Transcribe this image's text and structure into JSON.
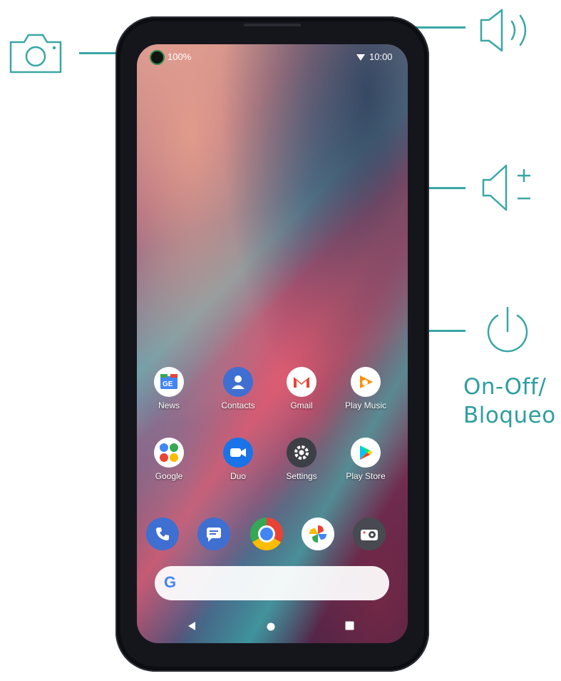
{
  "callouts": {
    "power_label_line1": "On-Off/",
    "power_label_line2": "Bloqueo",
    "icons": [
      "camera-icon",
      "speaker-icon",
      "volume-rocker-icon",
      "power-icon"
    ]
  },
  "status_bar": {
    "battery": "100%",
    "time": "10:00",
    "icons": [
      "wifi-icon"
    ]
  },
  "home": {
    "apps_row1": [
      {
        "label": "News",
        "icon": "news-icon",
        "color": "#ffffff"
      },
      {
        "label": "Contacts",
        "icon": "contacts-icon",
        "color": "#3f6fd1"
      },
      {
        "label": "Gmail",
        "icon": "gmail-icon",
        "color": "#ffffff"
      },
      {
        "label": "Play Music",
        "icon": "play-music-icon",
        "color": "#ffffff"
      }
    ],
    "apps_row2": [
      {
        "label": "Google",
        "icon": "google-folder-icon",
        "color": "#ffffff"
      },
      {
        "label": "Duo",
        "icon": "duo-icon",
        "color": "#1a73e8"
      },
      {
        "label": "Settings",
        "icon": "settings-icon",
        "color": "#3c3f45"
      },
      {
        "label": "Play Store",
        "icon": "play-store-icon",
        "color": "#ffffff"
      }
    ],
    "dock": [
      {
        "icon": "phone-icon",
        "color": "#3f6fd1"
      },
      {
        "icon": "messages-icon",
        "color": "#3f6fd1"
      },
      {
        "icon": "chrome-icon",
        "color": "#ffffff"
      },
      {
        "icon": "photos-icon",
        "color": "#ffffff"
      },
      {
        "icon": "camera-app-icon",
        "color": "#474a50"
      }
    ],
    "search_logo": "G"
  },
  "nav": {
    "icons": [
      "back-icon",
      "home-icon",
      "recents-icon"
    ]
  },
  "colors": {
    "accent": "#3aa6a6",
    "caption": "#2f9ea0",
    "phone_frame": "#15161c"
  }
}
